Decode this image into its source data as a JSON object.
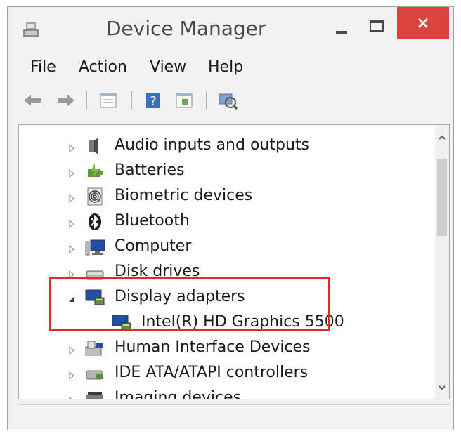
{
  "window": {
    "title": "Device Manager"
  },
  "menu": [
    "File",
    "Action",
    "View",
    "Help"
  ],
  "toolbar": {
    "icons": [
      "back-arrow-icon",
      "forward-arrow-icon",
      "properties-icon",
      "help-icon",
      "update-driver-icon",
      "scan-hardware-icon"
    ]
  },
  "tree": {
    "items": [
      {
        "label": "Audio inputs and outputs",
        "icon": "speaker-icon",
        "expanded": false
      },
      {
        "label": "Batteries",
        "icon": "battery-icon",
        "expanded": false
      },
      {
        "label": "Biometric devices",
        "icon": "fingerprint-icon",
        "expanded": false
      },
      {
        "label": "Bluetooth",
        "icon": "bluetooth-icon",
        "expanded": false
      },
      {
        "label": "Computer",
        "icon": "computer-icon",
        "expanded": false
      },
      {
        "label": "Disk drives",
        "icon": "disk-drive-icon",
        "expanded": false
      },
      {
        "label": "Display adapters",
        "icon": "display-adapter-icon",
        "expanded": true
      },
      {
        "label": "Intel(R) HD Graphics 5500",
        "icon": "display-adapter-icon",
        "child": true
      },
      {
        "label": "Human Interface Devices",
        "icon": "hid-icon",
        "expanded": false
      },
      {
        "label": "IDE ATA/ATAPI controllers",
        "icon": "ide-controller-icon",
        "expanded": false
      },
      {
        "label": "Imaging devices",
        "icon": "imaging-device-icon",
        "expanded": false
      }
    ]
  },
  "colors": {
    "highlight_border": "#e02a2a",
    "close_button": "#d9453c"
  }
}
